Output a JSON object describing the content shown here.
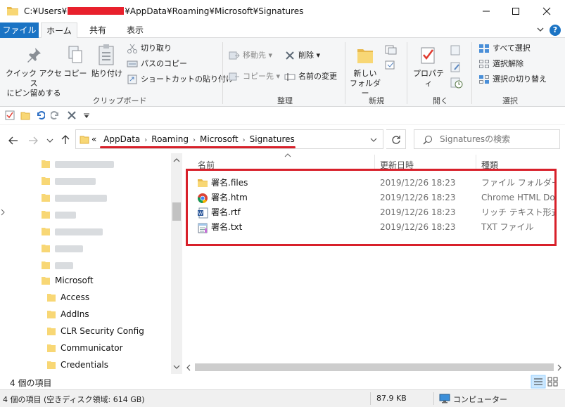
{
  "window": {
    "title_prefix": "C:¥Users¥",
    "title_suffix": "¥AppData¥Roaming¥Microsoft¥Signatures"
  },
  "ribbon_tabs": [
    "ファイル",
    "ホーム",
    "共有",
    "表示"
  ],
  "ribbon": {
    "clipboard": {
      "pin_label_1": "クイック アクセス",
      "pin_label_2": "にピン留めする",
      "copy": "コピー",
      "paste": "貼り付け",
      "cut": "切り取り",
      "copy_path": "パスのコピー",
      "paste_shortcut": "ショートカットの貼り付け",
      "group": "クリップボード"
    },
    "organize": {
      "move_to": "移動先",
      "copy_to": "コピー先",
      "delete": "削除",
      "rename": "名前の変更",
      "group": "整理"
    },
    "new": {
      "new_folder_1": "新しい",
      "new_folder_2": "フォルダー",
      "group": "新規"
    },
    "open": {
      "properties": "プロパティ",
      "group": "開く"
    },
    "select": {
      "select_all": "すべて選択",
      "select_none": "選択解除",
      "invert": "選択の切り替え",
      "group": "選択"
    }
  },
  "breadcrumb": {
    "overflow": "«",
    "items": [
      "AppData",
      "Roaming",
      "Microsoft",
      "Signatures"
    ]
  },
  "search": {
    "placeholder": "Signaturesの検索"
  },
  "nav_tree": {
    "microsoft": "Microsoft",
    "children": [
      "Access",
      "AddIns",
      "CLR Security Config",
      "Communicator",
      "Credentials"
    ]
  },
  "columns": {
    "name": "名前",
    "date": "更新日時",
    "type": "種類"
  },
  "files": [
    {
      "name": "署名.files",
      "date": "2019/12/26 18:23",
      "type": "ファイル フォルダー",
      "icon": "folder-icon"
    },
    {
      "name": "署名.htm",
      "date": "2019/12/26 18:23",
      "type": "Chrome HTML Do...",
      "icon": "chrome-icon"
    },
    {
      "name": "署名.rtf",
      "date": "2019/12/26 18:23",
      "type": "リッチ テキスト形式",
      "icon": "word-doc-icon"
    },
    {
      "name": "署名.txt",
      "date": "2019/12/26 18:23",
      "type": "TXT ファイル",
      "icon": "notepad-icon"
    }
  ],
  "status": {
    "item_count": "4 個の項目",
    "summary": "4 個の項目 (空きディスク領域: 614 GB)",
    "size": "87.9 KB",
    "location": "コンピューター"
  },
  "colors": {
    "accent": "#1a73c4",
    "annotation_red": "#d8202a",
    "folder": "#f8d775"
  }
}
